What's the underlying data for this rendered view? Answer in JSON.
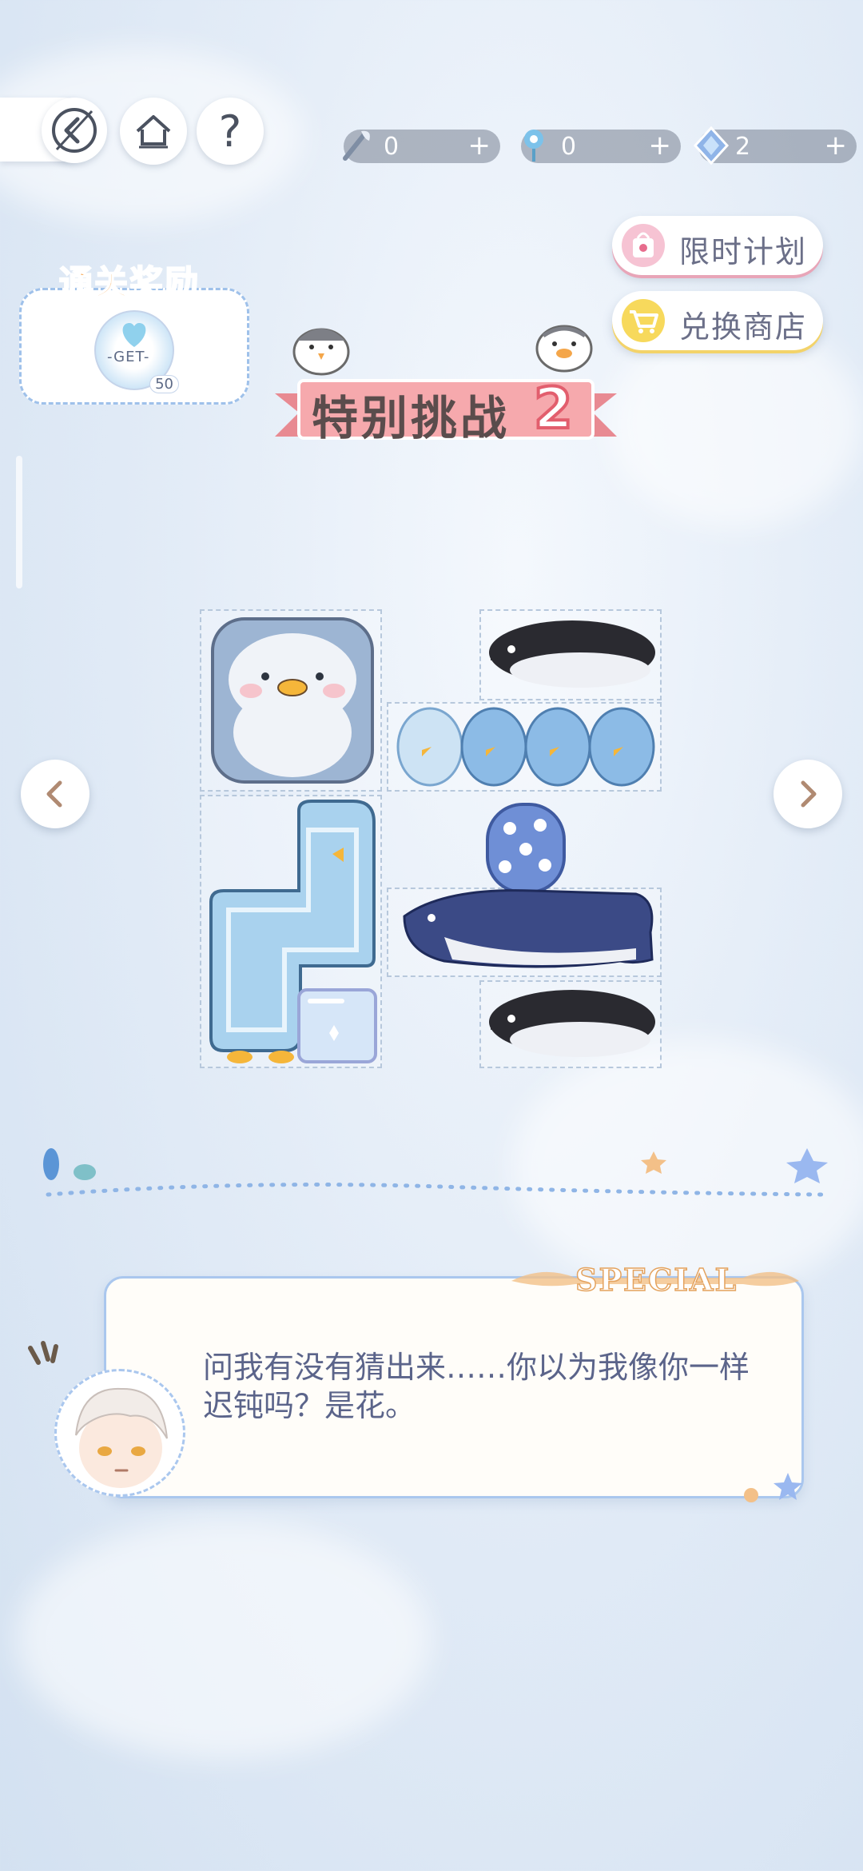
{
  "nav": {
    "back_icon": "back-arrow-icon",
    "home_icon": "home-icon",
    "help_label": "?"
  },
  "resources": [
    {
      "icon": "feather-brush-icon",
      "value": "0",
      "plus": "+"
    },
    {
      "icon": "blue-flower-icon",
      "value": "0",
      "plus": "+"
    },
    {
      "icon": "diamond-gem-icon",
      "value": "2",
      "plus": "+"
    }
  ],
  "side_buttons": {
    "limited_plan": "限时计划",
    "exchange_shop": "兑换商店"
  },
  "reward": {
    "title": "通关奖励",
    "get_label": "-GET-",
    "count": "50"
  },
  "banner": {
    "title": "特别挑战",
    "number": "2"
  },
  "dialog": {
    "tag": "SPECIAL",
    "line": "问我有没有猜出来……你以为我像你一样迟钝吗？是花。"
  },
  "colors": {
    "accent_pink": "#e25e6d",
    "dialog_text": "#5b648a",
    "reward_orange": "#f6a349",
    "frame_blue": "#aac7ee"
  }
}
